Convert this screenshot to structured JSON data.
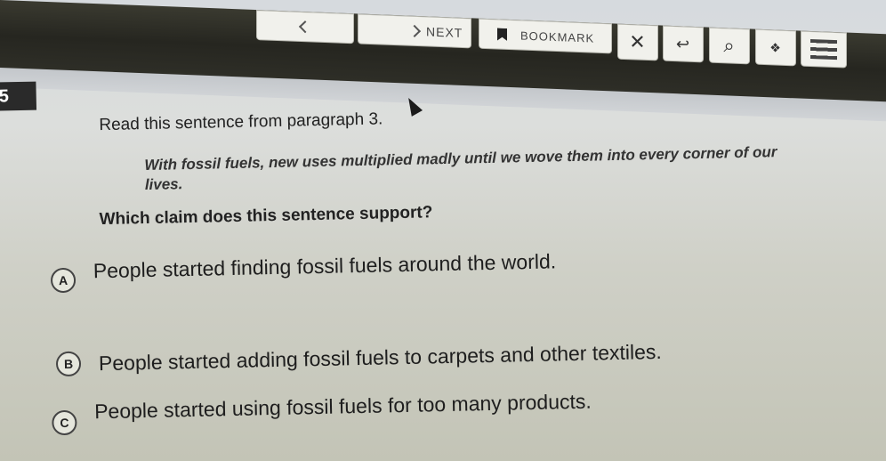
{
  "toolbar": {
    "next_label": "NEXT",
    "bookmark_label": "BOOKMARK",
    "close_glyph": "✕",
    "calc_glyph": "↩",
    "zoom_glyph": "⌕",
    "hint_glyph": "❖"
  },
  "question": {
    "number": "5",
    "prompt": "Read this sentence from paragraph 3.",
    "quote": "With fossil fuels, new uses multiplied madly until we wove them into every corner of our lives.",
    "text": "Which claim does this sentence support?",
    "choices": [
      {
        "letter": "A",
        "text": "People started finding fossil fuels around the world."
      },
      {
        "letter": "B",
        "text": "People started adding fossil fuels to carpets and other textiles."
      },
      {
        "letter": "C",
        "text": "People started using fossil fuels for too many products."
      }
    ]
  }
}
